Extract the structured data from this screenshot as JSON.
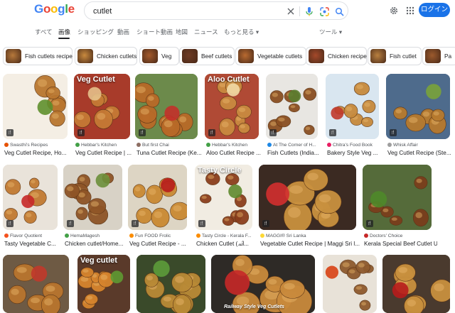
{
  "logo": {
    "letters": [
      "G",
      "o",
      "o",
      "g",
      "l",
      "e"
    ],
    "colors": [
      "#4285f4",
      "#ea4335",
      "#fbbc05",
      "#4285f4",
      "#34a853",
      "#ea4335"
    ]
  },
  "search": {
    "query": "cutlet"
  },
  "header": {
    "login_label": "ログイン"
  },
  "tabs": [
    {
      "label": "すべて"
    },
    {
      "label": "画像",
      "active": true
    },
    {
      "label": "ショッピング"
    },
    {
      "label": "動画"
    },
    {
      "label": "ショート動画"
    },
    {
      "label": "地図"
    },
    {
      "label": "ニュース"
    },
    {
      "label": "もっと見る ▾"
    }
  ],
  "tools_label": "ツール ▾",
  "chips": [
    {
      "label": "Fish cutlets recipe",
      "color": "#b7793b"
    },
    {
      "label": "Chicken cutlets",
      "color": "#c98a3e"
    },
    {
      "label": "Veg",
      "color": "#a45a2c"
    },
    {
      "label": "Beef cutlets",
      "color": "#6e3b24"
    },
    {
      "label": "Vegetable cutlets",
      "color": "#b96a30"
    },
    {
      "label": "Chicken recipe",
      "color": "#a5492a"
    },
    {
      "label": "Fish cutlet",
      "color": "#b9803f"
    },
    {
      "label": "Pa",
      "color": "#9c5a2d"
    }
  ],
  "results": [
    {
      "source": "Swasthi's Recipes",
      "title": "Veg Cutlet Recipe, Ho...",
      "bg": "#f4eee4",
      "food": "#b9762f",
      "accent": "#5f8f2c",
      "fav": "#e65100"
    },
    {
      "source": "Hebbar's Kitchen",
      "title": "Veg Cutlet Recipe | ...",
      "bg": "#a83b2a",
      "food": "#c57a35",
      "accent": "#e4c089",
      "fav": "#43a047",
      "overlay": "Veg Cutlet"
    },
    {
      "source": "But first Chai",
      "title": "Tuna Cutlet Recipe (Ke...",
      "bg": "#6c8a4b",
      "food": "#b86a28",
      "accent": "#c3302a",
      "fav": "#8d6e63"
    },
    {
      "source": "Hebbar's Kitchen",
      "title": "Aloo Cutlet Recipe ...",
      "bg": "#b04a35",
      "food": "#c98a40",
      "accent": "#f1d9a5",
      "fav": "#43a047",
      "overlay": "Aloo Cutlet"
    },
    {
      "source": "At The Corner of H...",
      "title": "Fish Cutlets (India...",
      "bg": "#e8e6e2",
      "food": "#8a4f22",
      "accent": "#5a7d2f",
      "fav": "#1e88e5"
    },
    {
      "source": "Chitra's Food Book",
      "title": "Bakery Style Veg ...",
      "bg": "#d9e6f0",
      "food": "#c78a3c",
      "accent": "#c0392b",
      "fav": "#e91e63"
    },
    {
      "source": "Whisk Affair",
      "title": "Veg Cutlet Recipe (Ste...",
      "bg": "#4e6b8c",
      "food": "#b77a2e",
      "accent": "#7aa33a",
      "fav": "#9e9e9e"
    },
    {
      "source": "Flavor Quotient",
      "title": "Tasty Vegetable C...",
      "bg": "#e9e3da",
      "food": "#c27a32",
      "accent": "#c62828",
      "fav": "#f4511e"
    },
    {
      "source": "HemaMagesh",
      "title": "Chicken cutlet/Home...",
      "bg": "#d8d2c6",
      "food": "#8e5426",
      "accent": "#6b8f3a",
      "fav": "#43a047"
    },
    {
      "source": "Fun FOOD Frolic",
      "title": "Veg Cutlet Recipe - ...",
      "bg": "#ddd5c4",
      "food": "#c98a33",
      "accent": "#b71c1c",
      "fav": "#fb8c00"
    },
    {
      "source": "Tasty Circle - Kerala F...",
      "title": "Chicken Cutlet (ചി...",
      "bg": "#f1ece2",
      "food": "#8b3f1c",
      "accent": "#5e8a2e",
      "fav": "#fb8c00",
      "overlay": "Tasty Circle"
    },
    {
      "source": "MAGGI® Sri Lanka",
      "title": "Vegetable Cutlet Recipe | Maggi Sri l...",
      "bg": "#3b2a22",
      "food": "#c9913f",
      "accent": "#d32f2f",
      "fav": "#fdd835"
    },
    {
      "source": "Doctors' Choice",
      "title": "Kerala Special Beef Cutlet Using ...",
      "bg": "#556b3a",
      "food": "#7a3e1c",
      "accent": "#4f8a2a",
      "fav": "#c62828"
    },
    {
      "source": "",
      "title": "",
      "bg": "#6e5a44",
      "food": "#b8752e",
      "accent": "#c0392b",
      "fav": "#999999"
    },
    {
      "source": "",
      "title": "",
      "bg": "#5a3a2a",
      "food": "#d6842e",
      "accent": "#5e9a32",
      "fav": "#999999",
      "overlay": "Veg cutlet"
    },
    {
      "source": "",
      "title": "",
      "bg": "#3a4a2a",
      "food": "#b98a36",
      "accent": "#5d9c3a",
      "fav": "#999999"
    },
    {
      "source": "",
      "title": "",
      "bg": "#2e2a26",
      "food": "#c98a3c",
      "accent": "#c62828",
      "fav": "#999999",
      "overlay": "Railway Style Veg Cutlets"
    },
    {
      "source": "",
      "title": "",
      "bg": "#e8e2d8",
      "food": "#8e5a2e",
      "accent": "#d84315",
      "fav": "#999999"
    },
    {
      "source": "",
      "title": "",
      "bg": "#4a3a2e",
      "food": "#c8903e",
      "accent": "#b71c1c",
      "fav": "#999999"
    }
  ]
}
